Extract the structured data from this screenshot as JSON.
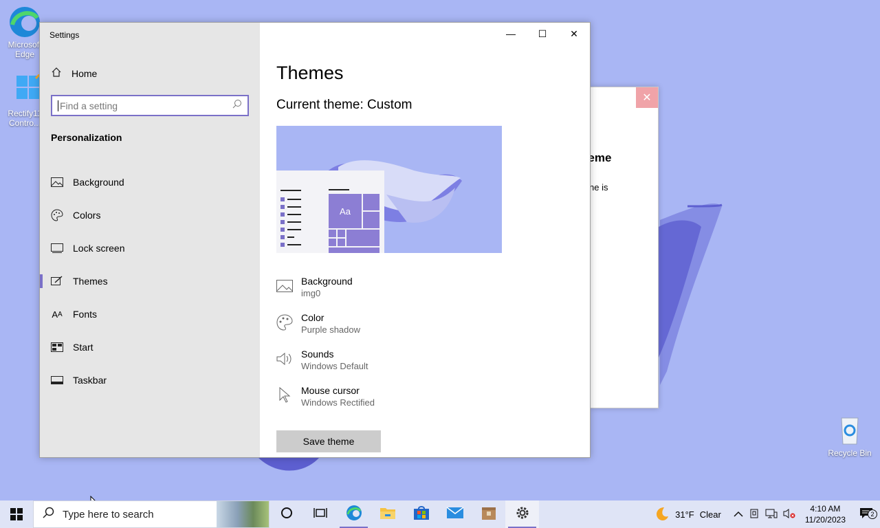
{
  "desktop": {
    "icons": [
      {
        "label": "Microsoft Edge",
        "icon": "edge-icon"
      },
      {
        "label": "Rectify11 Contro...",
        "icon": "control-panel-icon"
      },
      {
        "label": "Recycle Bin",
        "icon": "recycle-bin-icon"
      }
    ],
    "background_dialog": {
      "close_glyph": "✕",
      "heading": "t theme",
      "line1": "l",
      "line2": "ne is"
    }
  },
  "settings": {
    "window_title": "Settings",
    "controls": {
      "minimize": "—",
      "maximize": "☐",
      "close": "✕"
    },
    "sidebar": {
      "home_label": "Home",
      "search_placeholder": "Find a setting",
      "section_title": "Personalization",
      "items": [
        {
          "label": "Background",
          "icon": "image-icon",
          "active": false
        },
        {
          "label": "Colors",
          "icon": "palette-icon",
          "active": false
        },
        {
          "label": "Lock screen",
          "icon": "monitor-icon",
          "active": false
        },
        {
          "label": "Themes",
          "icon": "brush-icon",
          "active": true
        },
        {
          "label": "Fonts",
          "icon": "font-icon",
          "active": false
        },
        {
          "label": "Start",
          "icon": "start-icon",
          "active": false
        },
        {
          "label": "Taskbar",
          "icon": "taskbar-icon",
          "active": false
        }
      ]
    },
    "main": {
      "title": "Themes",
      "current_theme": "Current theme: Custom",
      "preview_sample": "Aa",
      "properties": [
        {
          "title": "Background",
          "value": "img0",
          "icon": "image-icon"
        },
        {
          "title": "Color",
          "value": "Purple shadow",
          "icon": "palette-icon"
        },
        {
          "title": "Sounds",
          "value": "Windows Default",
          "icon": "speaker-icon"
        },
        {
          "title": "Mouse cursor",
          "value": "Windows Rectified",
          "icon": "cursor-icon"
        }
      ],
      "save_button": "Save theme"
    }
  },
  "taskbar": {
    "search_placeholder": "Type here to search",
    "weather_temp": "31°F",
    "weather_text": "Clear",
    "time": "4:10 AM",
    "date": "11/20/2023",
    "notification_count": "2"
  },
  "colors": {
    "accent": "#7a70c8",
    "wallpaper": "#a9b6f4",
    "sidebar_bg": "#e6e6e6"
  }
}
